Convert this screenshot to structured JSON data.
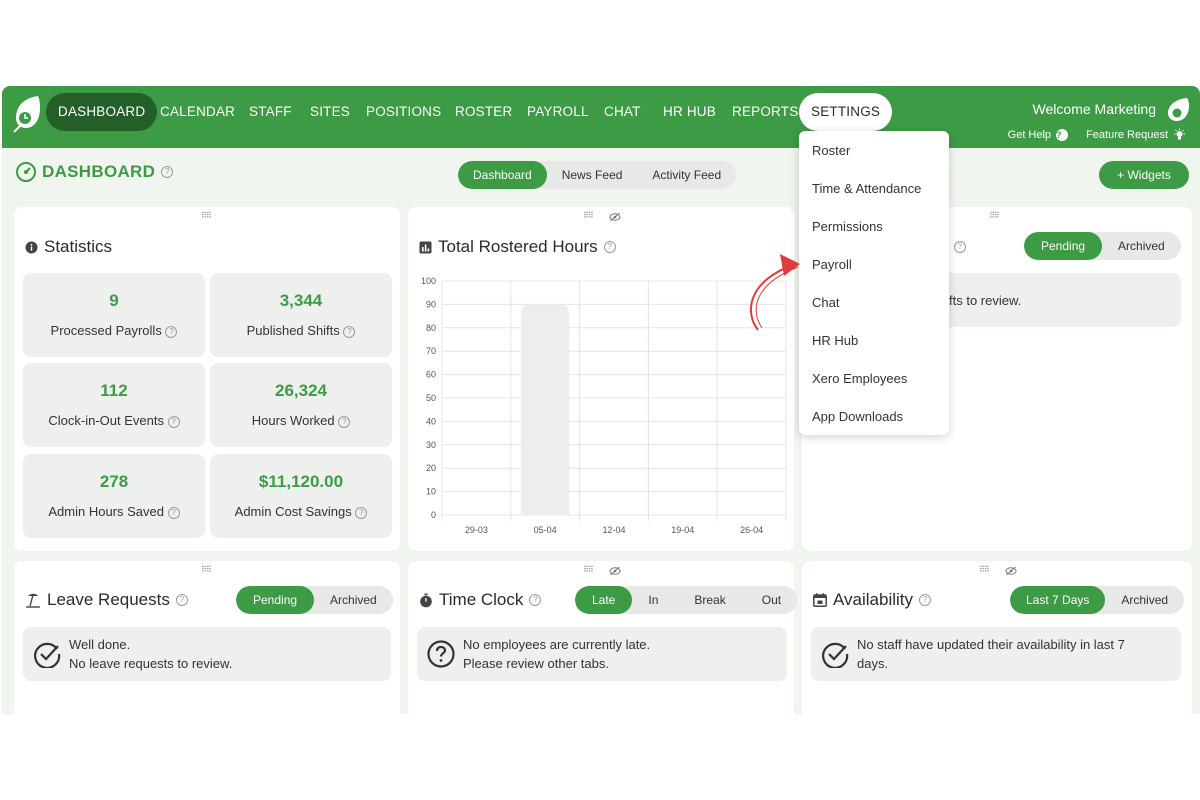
{
  "nav": {
    "items": [
      "DASHBOARD",
      "CALENDAR",
      "STAFF",
      "SITES",
      "POSITIONS",
      "ROSTER",
      "PAYROLL",
      "CHAT",
      "HR HUB",
      "REPORTS",
      "SETTINGS"
    ],
    "welcome": "Welcome Marketing",
    "get_help": "Get Help",
    "feature_request": "Feature Request"
  },
  "page": {
    "title": "DASHBOARD",
    "tabs": [
      "Dashboard",
      "News Feed",
      "Activity Feed"
    ],
    "widgets_button": "+ Widgets"
  },
  "statistics": {
    "title": "Statistics",
    "items": [
      {
        "value": "9",
        "label": "Processed Payrolls"
      },
      {
        "value": "3,344",
        "label": "Published Shifts"
      },
      {
        "value": "112",
        "label": "Clock-in-Out Events"
      },
      {
        "value": "26,324",
        "label": "Hours Worked"
      },
      {
        "value": "278",
        "label": "Admin Hours Saved"
      },
      {
        "value": "$11,120.00",
        "label": "Admin Cost Savings"
      }
    ]
  },
  "chart": {
    "title": "Total Rostered Hours"
  },
  "chart_data": {
    "type": "bar",
    "categories": [
      "29-03",
      "05-04",
      "12-04",
      "19-04",
      "26-04"
    ],
    "values": [
      0,
      90,
      0,
      0,
      0
    ],
    "title": "Total Rostered Hours",
    "ylim": [
      0,
      100
    ],
    "yticks": [
      0,
      10,
      20,
      30,
      40,
      50,
      60,
      70,
      80,
      90,
      100
    ],
    "grid": true,
    "bar_color": "#eceeed"
  },
  "shifts": {
    "tabs": [
      "Pending",
      "Archived"
    ],
    "message_fragment": "fts to review."
  },
  "leave": {
    "title": "Leave Requests",
    "tabs": [
      "Pending",
      "Archived"
    ],
    "line1": "Well done.",
    "line2": "No leave requests to review."
  },
  "timeclock": {
    "title": "Time Clock",
    "tabs": [
      "Late",
      "In",
      "Break",
      "Out"
    ],
    "line1": "No employees are currently late.",
    "line2": "Please review other tabs."
  },
  "availability": {
    "title": "Availability",
    "tabs": [
      "Last 7 Days",
      "Archived"
    ],
    "line1": "No staff have updated their availability in last 7",
    "line2": "days."
  },
  "settings_menu": {
    "items": [
      "Roster",
      "Time & Attendance",
      "Permissions",
      "Payroll",
      "Chat",
      "HR Hub",
      "Xero Employees",
      "App Downloads"
    ]
  },
  "colors": {
    "brand": "#3d9b45",
    "brand_dark": "#245f2a",
    "annotation_arrow": "#e03a3a"
  }
}
